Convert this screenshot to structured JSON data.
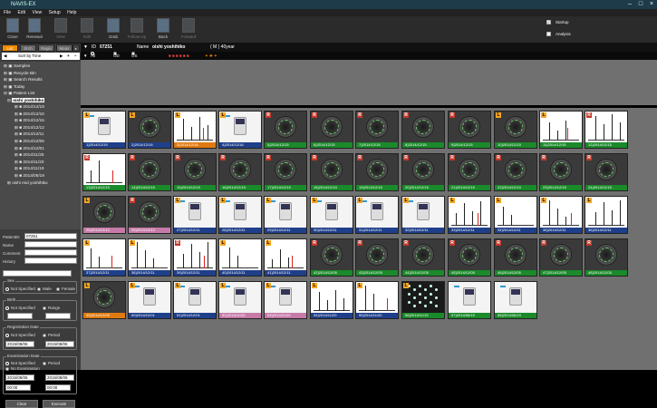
{
  "window": {
    "title": "NAVIS-EX"
  },
  "menu": [
    "File",
    "Edit",
    "View",
    "Setup",
    "Help"
  ],
  "toolbar": [
    {
      "label": "Close",
      "icon": "close-icon",
      "state": "on"
    },
    {
      "label": "Renewal",
      "icon": "renewal-icon",
      "state": "on"
    },
    {
      "label": "View",
      "icon": "view-icon",
      "state": "dim"
    },
    {
      "label": "Edit",
      "icon": "edit-icon",
      "state": "dim"
    },
    {
      "label": "Grab",
      "icon": "grab-icon",
      "state": "on"
    },
    {
      "label": "Follow-Up",
      "icon": "follow-up-icon",
      "state": "dim"
    },
    {
      "label": "Back",
      "icon": "back-icon",
      "state": "on"
    },
    {
      "label": "Forward",
      "icon": "forward-icon",
      "state": "dim"
    }
  ],
  "toolbar_checks": [
    {
      "label": "Startup",
      "checked": true
    },
    {
      "label": "Analysis",
      "checked": false
    }
  ],
  "left_tabs": [
    "List",
    "Srch",
    "Regis",
    "Meas"
  ],
  "sort_label": "Sort by Time",
  "tree": {
    "roots": [
      "Samples",
      "Recycle Bin",
      "Search Results",
      "Today",
      "Patient List"
    ],
    "selected_patient": "oishi yoshihiko",
    "dates": [
      "2014/12/19",
      "2014/12/16",
      "2014/12/15",
      "2014/12/12",
      "2014/12/11",
      "2014/12/05",
      "2014/12/01",
      "2014/11/25",
      "2014/11/20",
      "2014/11/19",
      "2014/06/19"
    ],
    "other_patient": "oishi mid yoshihiko"
  },
  "patient_form": {
    "id_label": "PatientID",
    "id_value": "07251",
    "name_label": "Name",
    "comment_label": "Comment",
    "history_label": "History"
  },
  "sex_group": {
    "title": "Sex",
    "options": [
      "Not Specified",
      "Male",
      "Female"
    ]
  },
  "birth_group": {
    "title": "Birth",
    "options": [
      "Not Specified",
      "Range"
    ]
  },
  "reg_group": {
    "title": "Registration Date",
    "options": [
      "Not Specified",
      "Period"
    ],
    "from": "2015/08/06",
    "to": "2015/08/06"
  },
  "exam_group": {
    "title": "Examination Date",
    "options": [
      "Not Specified",
      "Period",
      "No Examination"
    ],
    "from": "2015/08/06",
    "to": "2015/08/06",
    "time_from": "00:00",
    "time_to": "00:00"
  },
  "buttons": {
    "clear": "Clear",
    "execute": "Execute"
  },
  "patbar": {
    "id_label": "ID",
    "id": "07251",
    "name_label": "Name",
    "name": "oishi  yoshihiko",
    "sex_age": "( M )  40year"
  },
  "filterbar": {
    "options": [
      "All Eye",
      "OD",
      "OS"
    ]
  },
  "thumbnails": [
    {
      "n": "1)",
      "date": "2014/12/19",
      "eye": "L",
      "kind": "dev",
      "cap": "blue"
    },
    {
      "n": "2)",
      "date": "2014/12/16",
      "eye": "L",
      "kind": "eye",
      "cap": "blue"
    },
    {
      "n": "3)",
      "date": "2014/12/16",
      "eye": "L",
      "kind": "plot",
      "cap": "orange"
    },
    {
      "n": "4)",
      "date": "2014/12/16",
      "eye": "L",
      "kind": "dev",
      "cap": "blue"
    },
    {
      "n": "5)",
      "date": "2014/12/15",
      "eye": "R",
      "kind": "eye",
      "cap": "green"
    },
    {
      "n": "6)",
      "date": "2014/12/15",
      "eye": "R",
      "kind": "eye",
      "cap": "green"
    },
    {
      "n": "7)",
      "date": "2014/12/15",
      "eye": "R",
      "kind": "eye",
      "cap": "green"
    },
    {
      "n": "8)",
      "date": "2014/12/15",
      "eye": "R",
      "kind": "eye",
      "cap": "green"
    },
    {
      "n": "9)",
      "date": "2014/12/15",
      "eye": "R",
      "kind": "eye",
      "cap": "green"
    },
    {
      "n": "10)",
      "date": "2014/12/15",
      "eye": "L",
      "kind": "eye",
      "cap": "green"
    },
    {
      "n": "11)",
      "date": "2014/12/15",
      "eye": "L",
      "kind": "plot",
      "cap": "green"
    },
    {
      "n": "12)",
      "date": "2014/12/15",
      "eye": "R",
      "kind": "plot",
      "cap": "green"
    },
    {
      "n": "13)",
      "date": "2014/12/15",
      "eye": "R",
      "kind": "plot",
      "cap": "green"
    },
    {
      "n": "14)",
      "date": "2014/12/15",
      "eye": "R",
      "kind": "eye",
      "cap": "green"
    },
    {
      "n": "15)",
      "date": "2014/12/15",
      "eye": "R",
      "kind": "eye",
      "cap": "green"
    },
    {
      "n": "16)",
      "date": "2014/12/15",
      "eye": "R",
      "kind": "eye",
      "cap": "green"
    },
    {
      "n": "17)",
      "date": "2014/12/15",
      "eye": "R",
      "kind": "eye",
      "cap": "green"
    },
    {
      "n": "18)",
      "date": "2014/12/15",
      "eye": "R",
      "kind": "eye",
      "cap": "green"
    },
    {
      "n": "19)",
      "date": "2014/12/15",
      "eye": "R",
      "kind": "eye",
      "cap": "green"
    },
    {
      "n": "20)",
      "date": "2014/12/15",
      "eye": "R",
      "kind": "eye",
      "cap": "green"
    },
    {
      "n": "21)",
      "date": "2014/12/15",
      "eye": "R",
      "kind": "eye",
      "cap": "green"
    },
    {
      "n": "22)",
      "date": "2014/12/15",
      "eye": "R",
      "kind": "eye",
      "cap": "green"
    },
    {
      "n": "23)",
      "date": "2014/12/15",
      "eye": "R",
      "kind": "eye",
      "cap": "green"
    },
    {
      "n": "24)",
      "date": "2014/12/15",
      "eye": "R",
      "kind": "eye",
      "cap": "green"
    },
    {
      "n": "25)",
      "date": "2014/12/12",
      "eye": "L",
      "kind": "eye",
      "cap": "pink"
    },
    {
      "n": "26)",
      "date": "2014/12/12",
      "eye": "R",
      "kind": "eye",
      "cap": "pink"
    },
    {
      "n": "27)",
      "date": "2014/12/11",
      "eye": "L",
      "kind": "dev",
      "cap": "blue"
    },
    {
      "n": "28)",
      "date": "2014/12/11",
      "eye": "L",
      "kind": "dev",
      "cap": "blue"
    },
    {
      "n": "29)",
      "date": "2014/12/11",
      "eye": "L",
      "kind": "dev",
      "cap": "blue"
    },
    {
      "n": "30)",
      "date": "2014/12/11",
      "eye": "L",
      "kind": "dev",
      "cap": "blue"
    },
    {
      "n": "31)",
      "date": "2014/12/11",
      "eye": "L",
      "kind": "dev",
      "cap": "blue"
    },
    {
      "n": "32)",
      "date": "2014/12/11",
      "eye": "L",
      "kind": "dev",
      "cap": "blue"
    },
    {
      "n": "33)",
      "date": "2014/12/11",
      "eye": "L",
      "kind": "plot",
      "cap": "blue"
    },
    {
      "n": "34)",
      "date": "2014/12/11",
      "eye": "L",
      "kind": "plot",
      "cap": "blue"
    },
    {
      "n": "35)",
      "date": "2014/12/11",
      "eye": "L",
      "kind": "plot",
      "cap": "blue"
    },
    {
      "n": "36)",
      "date": "2014/12/11",
      "eye": "L",
      "kind": "plot",
      "cap": "blue"
    },
    {
      "n": "37)",
      "date": "2014/12/11",
      "eye": "L",
      "kind": "plot",
      "cap": "blue"
    },
    {
      "n": "38)",
      "date": "2014/12/11",
      "eye": "L",
      "kind": "plot",
      "cap": "blue"
    },
    {
      "n": "39)",
      "date": "2014/12/11",
      "eye": "R",
      "kind": "plot",
      "cap": "blue"
    },
    {
      "n": "40)",
      "date": "2014/12/11",
      "eye": "L",
      "kind": "plot",
      "cap": "blue"
    },
    {
      "n": "41)",
      "date": "2014/12/11",
      "eye": "L",
      "kind": "plot",
      "cap": "blue"
    },
    {
      "n": "42)",
      "date": "2014/12/05",
      "eye": "R",
      "kind": "eye",
      "cap": "green"
    },
    {
      "n": "43)",
      "date": "2014/12/05",
      "eye": "R",
      "kind": "eye",
      "cap": "green"
    },
    {
      "n": "44)",
      "date": "2014/12/05",
      "eye": "R",
      "kind": "eye",
      "cap": "green"
    },
    {
      "n": "45)",
      "date": "2014/12/05",
      "eye": "R",
      "kind": "eye",
      "cap": "green"
    },
    {
      "n": "46)",
      "date": "2014/12/05",
      "eye": "R",
      "kind": "eye",
      "cap": "green"
    },
    {
      "n": "47)",
      "date": "2014/12/05",
      "eye": "R",
      "kind": "eye",
      "cap": "green"
    },
    {
      "n": "48)",
      "date": "2014/12/05",
      "eye": "R",
      "kind": "eye",
      "cap": "green"
    },
    {
      "n": "49)",
      "date": "2014/12/05",
      "eye": "L",
      "kind": "eye",
      "cap": "orange"
    },
    {
      "n": "50)",
      "date": "2014/12/01",
      "eye": "L",
      "kind": "dev",
      "cap": "blue"
    },
    {
      "n": "51)",
      "date": "2014/12/01",
      "eye": "L",
      "kind": "dev",
      "cap": "blue"
    },
    {
      "n": "52)",
      "date": "2014/11/25",
      "eye": "L",
      "kind": "dev",
      "cap": "pink"
    },
    {
      "n": "53)",
      "date": "2014/11/25",
      "eye": "L",
      "kind": "dev",
      "cap": "pink"
    },
    {
      "n": "54)",
      "date": "2014/11/20",
      "eye": "L",
      "kind": "plot",
      "cap": "blue"
    },
    {
      "n": "55)",
      "date": "2014/11/20",
      "eye": "L",
      "kind": "plot",
      "cap": "blue"
    },
    {
      "n": "56)",
      "date": "2014/11/19",
      "eye": "L",
      "kind": "dots",
      "cap": "green"
    },
    {
      "n": "57)",
      "date": "2014/06/19",
      "eye": "",
      "kind": "dev",
      "cap": "green"
    },
    {
      "n": "58)",
      "date": "2014/06/19",
      "eye": "",
      "kind": "dev",
      "cap": "green"
    }
  ],
  "colors": {
    "blue": "#1f3f8a",
    "green": "#1a8a2a",
    "orange": "#e07a10",
    "pink": "#c77aa8",
    "accent": "#f08a00"
  }
}
